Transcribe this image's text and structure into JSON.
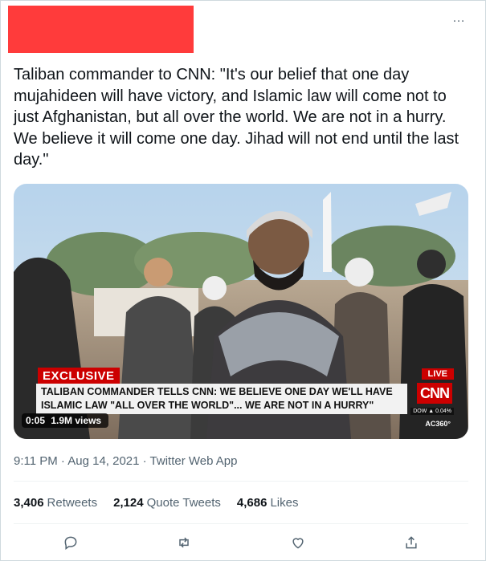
{
  "tweet": {
    "more_icon": "…",
    "text": "Taliban commander to CNN: \"It's our belief that one day mujahideen will have victory, and Islamic law will come not to just Afghanistan, but all over the world. We are not in a hurry. We believe it will come one day. Jihad will not end until the last day.\"",
    "media": {
      "exclusive_label": "EXCLUSIVE",
      "live_label": "LIVE",
      "network_logo": "CNN",
      "headline_line1": "TALIBAN COMMANDER TELLS CNN: WE BELIEVE ONE DAY WE'LL HAVE",
      "headline_line2": "ISLAMIC LAW \"ALL OVER THE WORLD\"... WE ARE NOT IN A HURRY\"",
      "ticker": "DOW ▲ 0.04%",
      "show_name": "AC360°",
      "duration": "0:05",
      "views": "1.9M views"
    },
    "timestamp": "9:11 PM · Aug 14, 2021 · Twitter Web App",
    "stats": {
      "retweets_count": "3,406",
      "retweets_label": "Retweets",
      "quotes_count": "2,124",
      "quotes_label": "Quote Tweets",
      "likes_count": "4,686",
      "likes_label": "Likes"
    }
  }
}
